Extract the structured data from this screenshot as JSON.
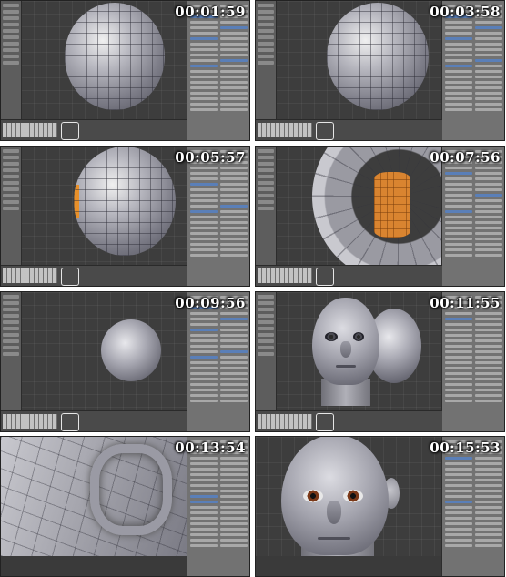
{
  "frames": [
    {
      "timecode": "00:01:59",
      "stage": "uv-sphere-mesh"
    },
    {
      "timecode": "00:03:58",
      "stage": "uv-sphere-subdivided"
    },
    {
      "timecode": "00:05:57",
      "stage": "sphere-edge-selected"
    },
    {
      "timecode": "00:07:56",
      "stage": "eye-socket-closeup"
    },
    {
      "timecode": "00:09:56",
      "stage": "smooth-sphere"
    },
    {
      "timecode": "00:11:55",
      "stage": "head-with-sphere"
    },
    {
      "timecode": "00:13:54",
      "stage": "wireframe-closeup"
    },
    {
      "timecode": "00:15:53",
      "stage": "finished-head"
    }
  ],
  "colors": {
    "viewport": "#3d3d3d",
    "panel": "#727272",
    "selection": "#e8902a",
    "active_button": "#5a7fb8",
    "timecode_text": "#ffffff"
  }
}
